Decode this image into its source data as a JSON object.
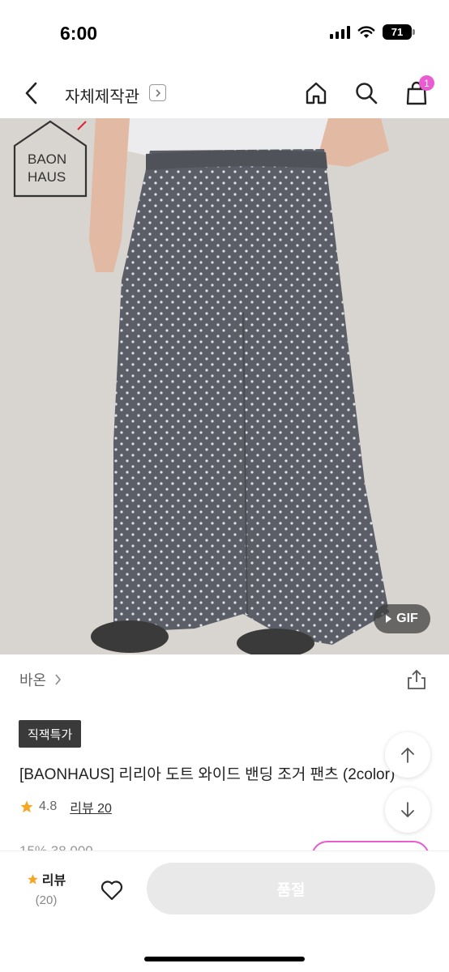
{
  "status": {
    "time": "6:00",
    "battery": "71"
  },
  "header": {
    "title": "자체제작관",
    "cart_count": "1"
  },
  "product_image": {
    "gif_label": "GIF",
    "logo_line1": "BAON",
    "logo_line2": "HAUS"
  },
  "brand": {
    "name": "바온"
  },
  "deal_badge": "직잭특가",
  "product": {
    "name": "[BAONHAUS] 리리아 도트 와이드 밴딩 조거 팬츠 (2color)"
  },
  "rating": {
    "score": "4.8",
    "review_link": "리뷰 20"
  },
  "price": {
    "discount": "15%",
    "original": "38,000"
  },
  "bottom": {
    "review_label": "리뷰",
    "review_count": "(20)",
    "soldout_label": "품절"
  },
  "colors": {
    "accent": "#e95bd0",
    "star": "#f5a623",
    "pants": "#5b5e66"
  }
}
